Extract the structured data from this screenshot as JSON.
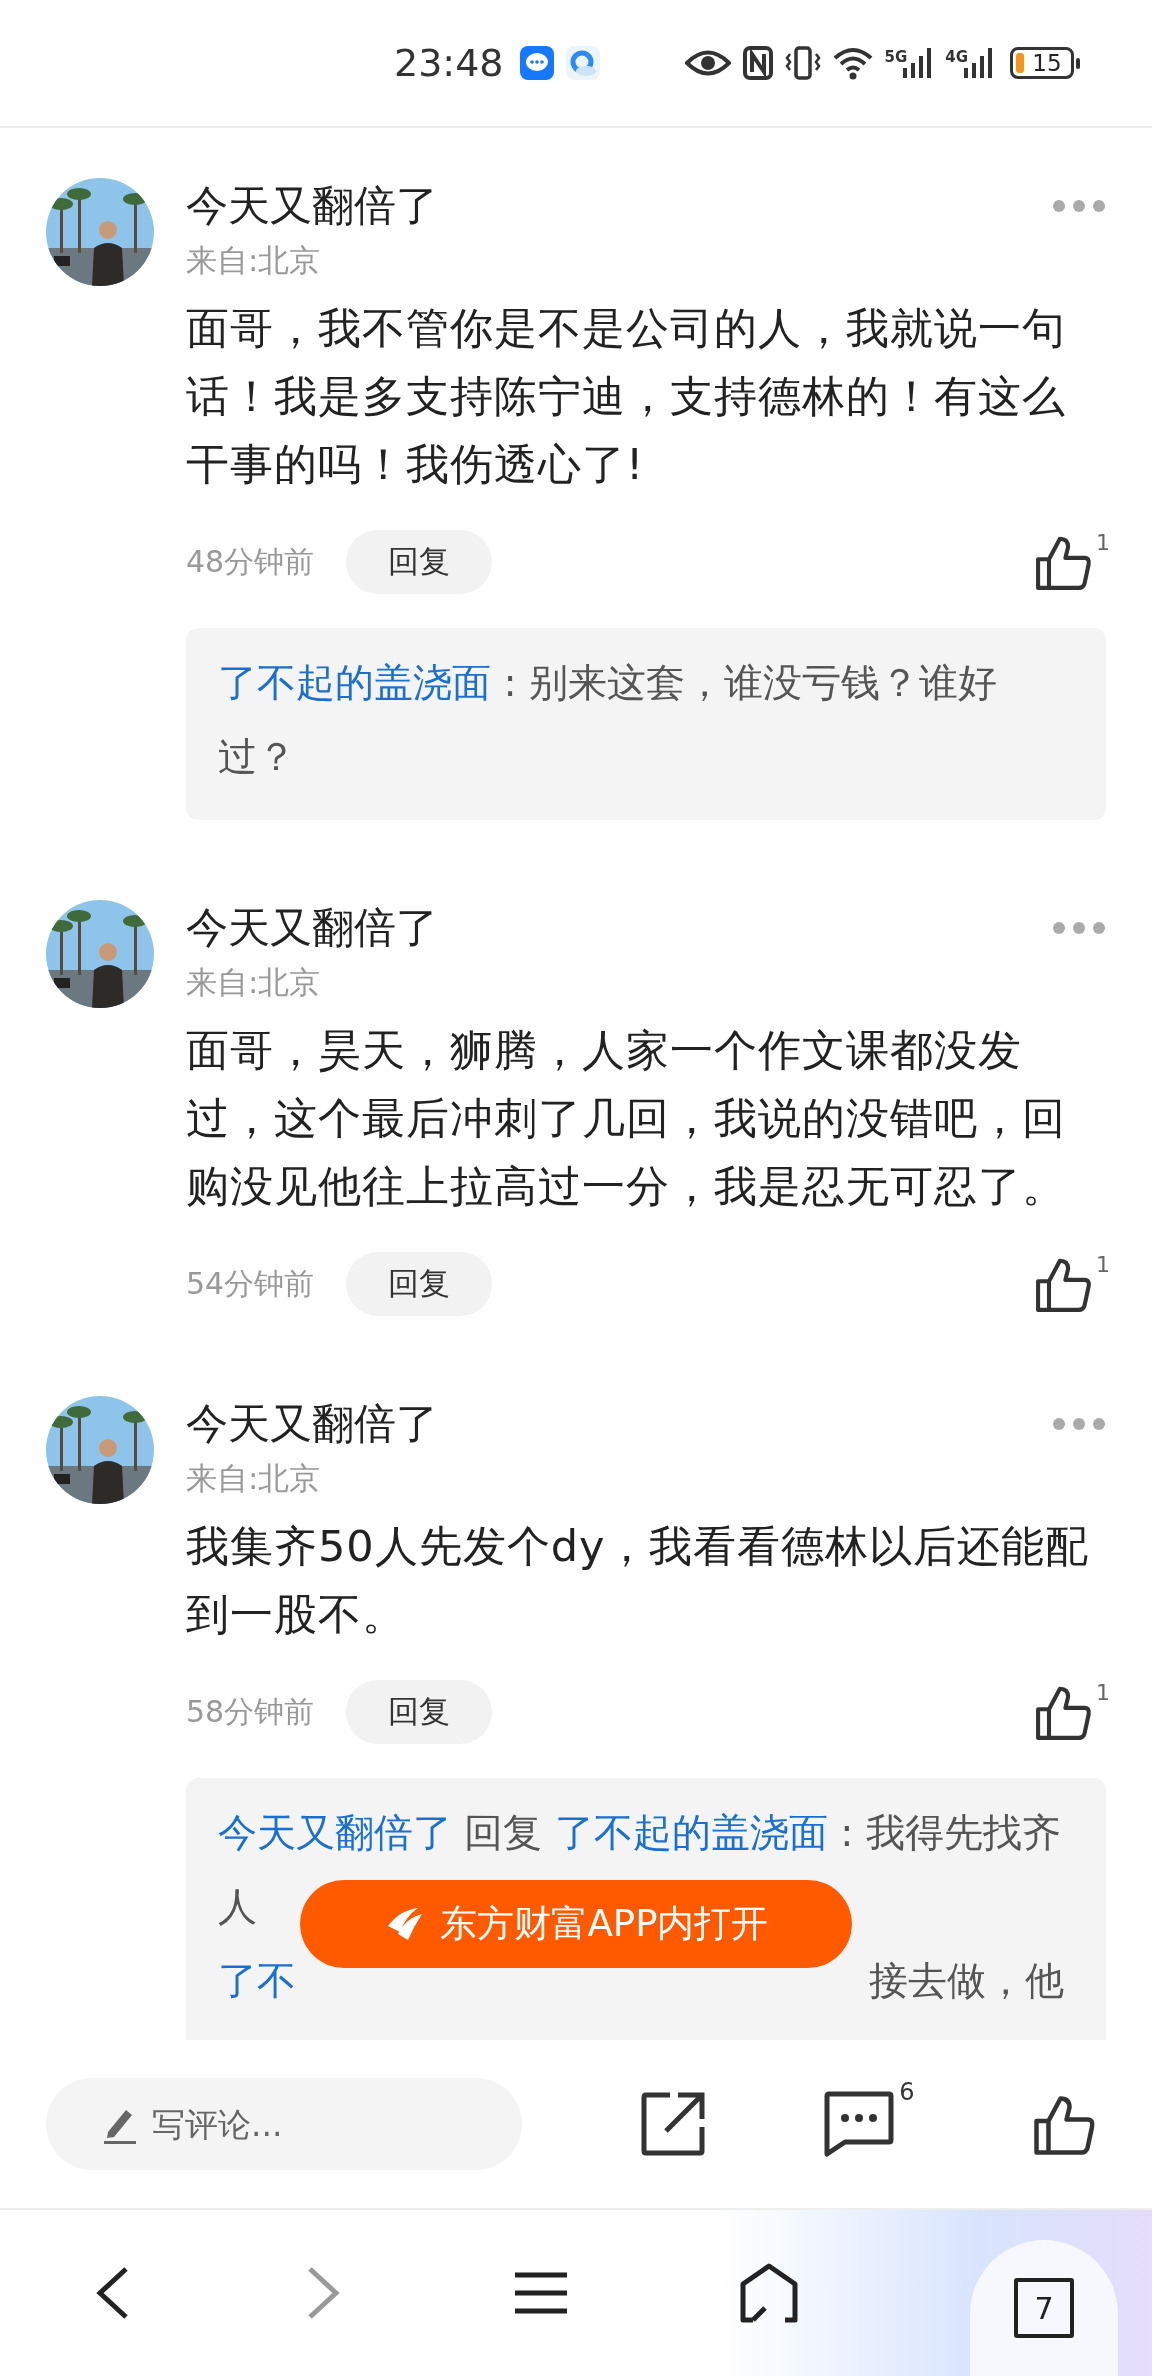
{
  "status_bar": {
    "time": "23:48",
    "signals": [
      "5G",
      "4G"
    ],
    "battery": "15"
  },
  "comments": [
    {
      "author": "今天又翻倍了",
      "location": "来自:北京",
      "text": "面哥，我不管你是不是公司的人，我就说一句话！我是多支持陈宁迪，支持德林的！有这么干事的吗！我伤透心了!",
      "time": "48分钟前",
      "reply_button": "回复",
      "likes": "1",
      "replies": [
        {
          "kind": "line",
          "segments": [
            {
              "kind": "user",
              "text": "了不起的盖浇面"
            },
            {
              "kind": "text",
              "text": " : 别来这套，谁没亏钱？谁好过？"
            }
          ]
        }
      ]
    },
    {
      "author": "今天又翻倍了",
      "location": "来自:北京",
      "text": "面哥，昊天，狮腾，人家一个作文课都没发过，这个最后冲刺了几回，我说的没错吧，回购没见他往上拉高过一分，我是忍无可忍了。",
      "time": "54分钟前",
      "reply_button": "回复",
      "likes": "1"
    },
    {
      "author": "今天又翻倍了",
      "location": "来自:北京",
      "text": "我集齐50人先发个dy，我看看德林以后还能配到一股不。",
      "time": "58分钟前",
      "reply_button": "回复",
      "likes": "1",
      "replies": [
        {
          "kind": "line",
          "segments": [
            {
              "kind": "user",
              "text": "今天又翻倍了"
            },
            {
              "kind": "text",
              "text": " 回复 "
            },
            {
              "kind": "user",
              "text": "了不起的盖浇面"
            },
            {
              "kind": "text",
              "text": " : 我得先找齐"
            },
            {
              "kind": "wrap",
              "text": "人"
            }
          ]
        },
        {
          "kind": "obscured",
          "segments": [
            {
              "kind": "user",
              "text": "了不"
            },
            {
              "kind": "text",
              "text": "接去做，他"
            }
          ]
        }
      ]
    }
  ],
  "open_app_button": "东方财富APP内打开",
  "comment_bar": {
    "placeholder": "写评论...",
    "comment_count": "6"
  },
  "nav_bar": {
    "tab_count": "7"
  }
}
